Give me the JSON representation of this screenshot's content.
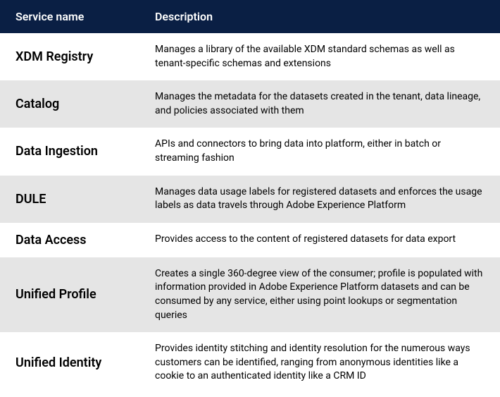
{
  "table": {
    "headers": {
      "name": "Service name",
      "desc": "Description"
    },
    "rows": [
      {
        "name": "XDM Registry",
        "desc": "Manages a library of the available XDM standard schemas as well as tenant-specific schemas and extensions"
      },
      {
        "name": "Catalog",
        "desc": "Manages the metadata for the datasets created in the tenant, data lineage, and policies associated with them"
      },
      {
        "name": "Data Ingestion",
        "desc": "APIs and connectors to bring data into platform, either in batch or streaming fashion"
      },
      {
        "name": "DULE",
        "desc": "Manages data usage labels for registered datasets and enforces the usage labels as data travels through Adobe Experience Platform"
      },
      {
        "name": "Data Access",
        "desc": "Provides access to the content of registered datasets for data export"
      },
      {
        "name": "Unified Profile",
        "desc": "Creates a single 360-degree view of the consumer; profile is populated with information provided in Adobe Experience Platform datasets and can be consumed by any service, either using point lookups or segmentation queries"
      },
      {
        "name": "Unified Identity",
        "desc": "Provides identity stitching and identity resolution for the numerous ways customers can be identified, ranging from anonymous identities like a cookie to an authenticated identity like a CRM ID"
      }
    ]
  }
}
